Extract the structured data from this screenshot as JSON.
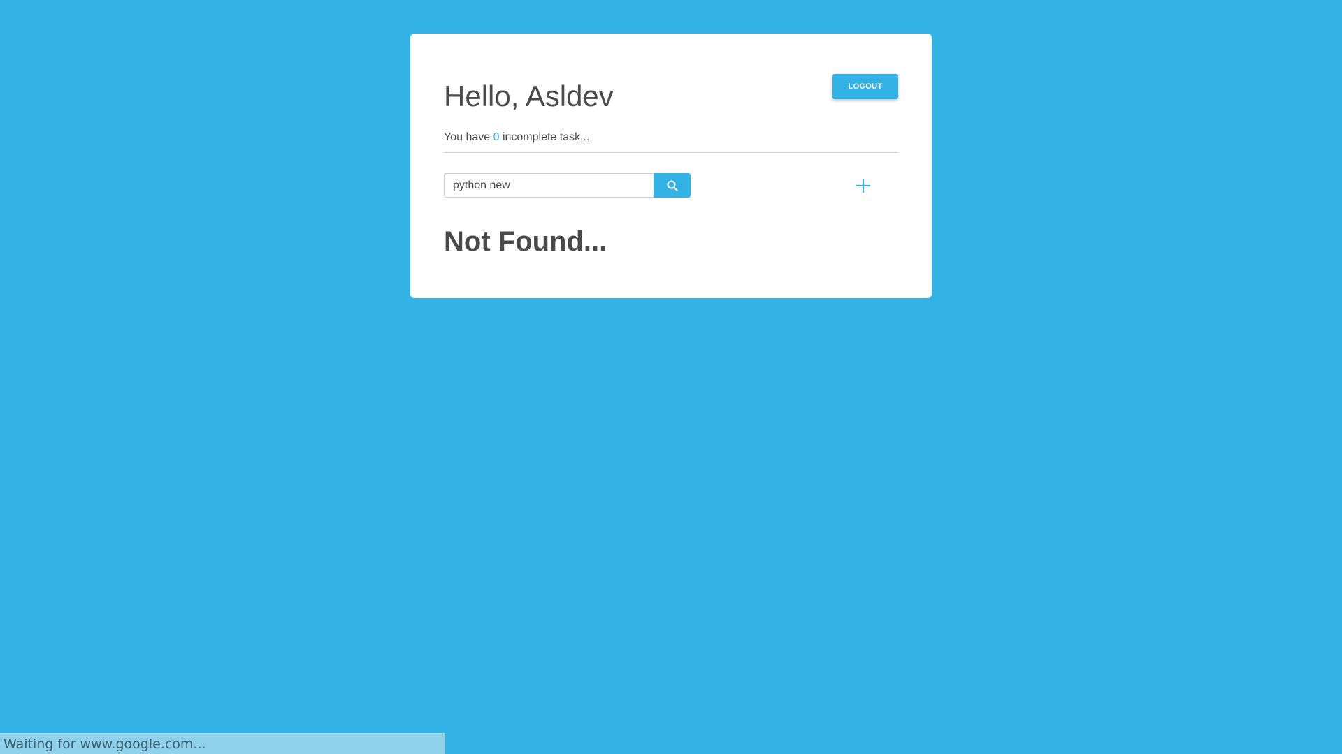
{
  "header": {
    "greeting": "Hello, Asldev",
    "logout_label": "LOGOUT"
  },
  "tasks": {
    "prefix": "You have ",
    "count": "0",
    "suffix": " incomplete task..."
  },
  "search": {
    "value": "python new",
    "icon": "search-icon"
  },
  "add_button": {
    "icon": "plus-icon"
  },
  "result": {
    "message": "Not Found..."
  },
  "status_bar": {
    "text": "Waiting for www.google.com..."
  },
  "colors": {
    "background": "#33b3e5",
    "accent": "#33b3e5",
    "card": "#ffffff",
    "text": "#4a4a4a"
  }
}
